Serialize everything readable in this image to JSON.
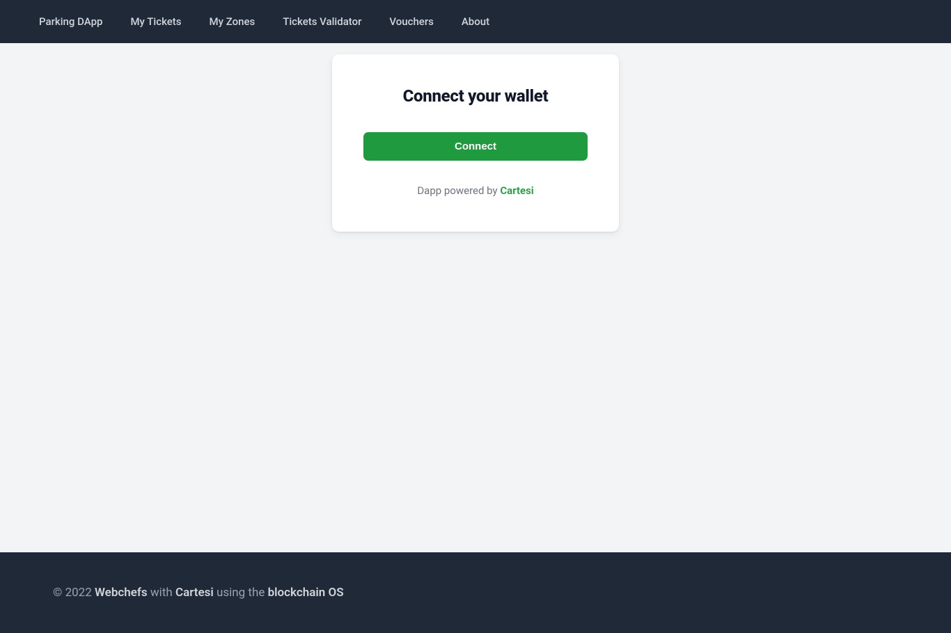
{
  "nav": {
    "items": [
      {
        "label": "Parking DApp"
      },
      {
        "label": "My Tickets"
      },
      {
        "label": "My Zones"
      },
      {
        "label": "Tickets Validator"
      },
      {
        "label": "Vouchers"
      },
      {
        "label": "About"
      }
    ]
  },
  "card": {
    "title": "Connect your wallet",
    "connect_label": "Connect",
    "powered_prefix": "Dapp powered by ",
    "powered_link": "Cartesi"
  },
  "footer": {
    "copyright": "© 2022 ",
    "company1": "Webchefs",
    "with_text": " with ",
    "company2": "Cartesi",
    "using_text": " using the ",
    "platform": "blockchain OS"
  }
}
